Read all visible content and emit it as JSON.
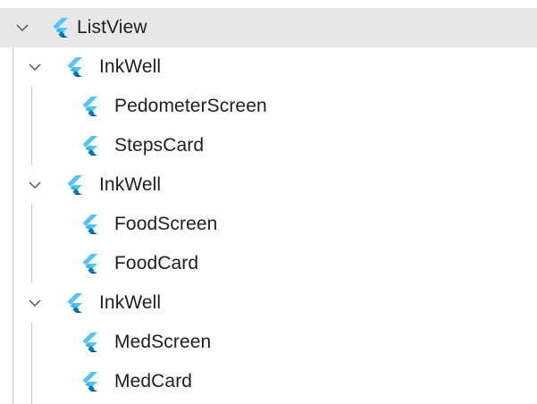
{
  "tree": {
    "root": {
      "label": "ListView",
      "expanded": true,
      "selected": true,
      "children": [
        {
          "label": "InkWell",
          "expanded": true,
          "children": [
            {
              "label": "PedometerScreen"
            },
            {
              "label": "StepsCard"
            }
          ]
        },
        {
          "label": "InkWell",
          "expanded": true,
          "children": [
            {
              "label": "FoodScreen"
            },
            {
              "label": "FoodCard"
            }
          ]
        },
        {
          "label": "InkWell",
          "expanded": true,
          "children": [
            {
              "label": "MedScreen"
            },
            {
              "label": "MedCard"
            }
          ]
        }
      ]
    }
  },
  "colors": {
    "selection_background": "#e8e8e8",
    "flutter_light_blue": "#54c5f8",
    "flutter_dark_blue": "#01579b",
    "guide_line": "#c8c8c8"
  },
  "icons": {
    "expander": "chevron-down-icon",
    "widget": "flutter-icon"
  }
}
